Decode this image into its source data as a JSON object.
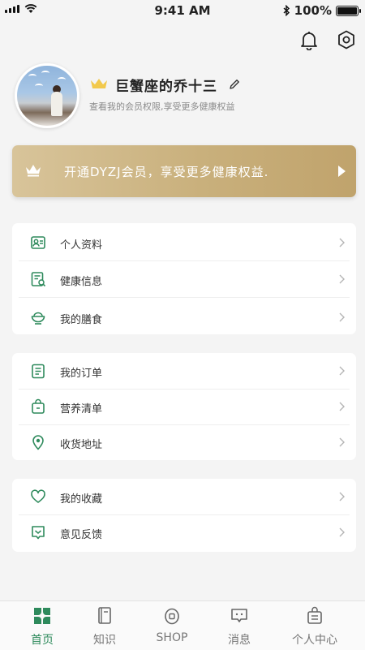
{
  "status_bar": {
    "time": "9:41 AM",
    "battery": "100%",
    "battery_level": 1.0,
    "icons": [
      "signal-icon",
      "wifi-icon",
      "bluetooth-icon",
      "battery-icon"
    ]
  },
  "top_icons": [
    "bell-icon",
    "settings-icon"
  ],
  "profile": {
    "username": "巨蟹座的乔十三",
    "subtitle": "查看我的会员权限,享受更多健康权益"
  },
  "vip_banner": {
    "text": "开通DYZJ会员，享受更多健康权益."
  },
  "groups": [
    {
      "items": [
        {
          "label": "个人资料",
          "icon": "profile-card-icon"
        },
        {
          "label": "健康信息",
          "icon": "health-report-icon"
        },
        {
          "label": "我的膳食",
          "icon": "meal-bowl-icon"
        }
      ]
    },
    {
      "items": [
        {
          "label": "我的订单",
          "icon": "order-list-icon"
        },
        {
          "label": "营养清单",
          "icon": "shopping-bag-icon"
        },
        {
          "label": "收货地址",
          "icon": "location-pin-icon"
        }
      ]
    },
    {
      "items": [
        {
          "label": "我的收藏",
          "icon": "heart-icon"
        },
        {
          "label": "意见反馈",
          "icon": "feedback-icon"
        }
      ]
    }
  ],
  "tabs": [
    {
      "label": "首页",
      "icon": "home-grid-icon",
      "active": true
    },
    {
      "label": "知识",
      "icon": "book-icon",
      "active": false
    },
    {
      "label": "SHOP",
      "icon": "shop-icon",
      "active": false
    },
    {
      "label": "消息",
      "icon": "message-icon",
      "active": false
    },
    {
      "label": "个人中心",
      "icon": "person-center-icon",
      "active": false
    }
  ],
  "colors": {
    "accent_green": "#2e8a5c",
    "gold": "#c9b07c",
    "crown_gold": "#f2c94c"
  }
}
